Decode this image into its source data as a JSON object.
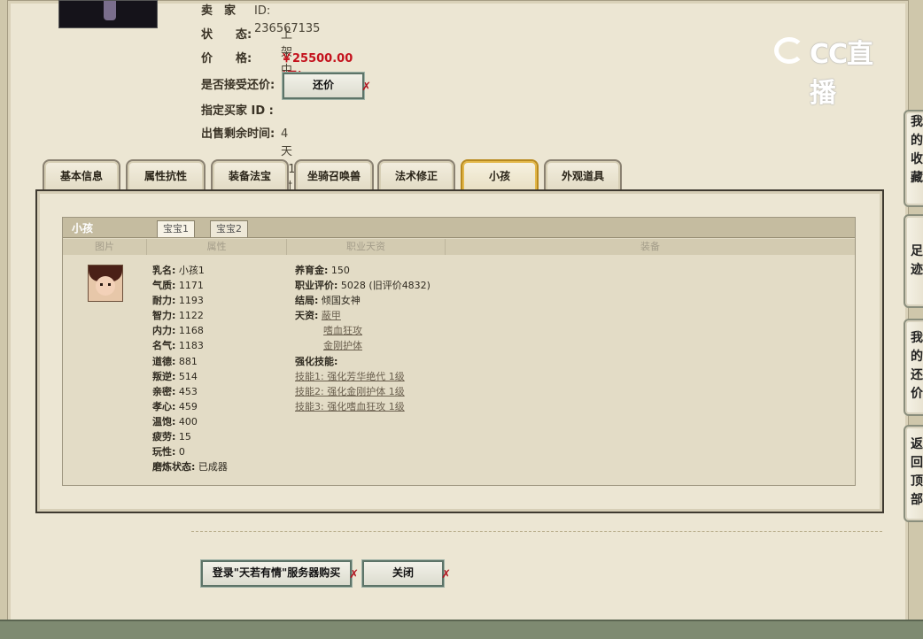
{
  "seller": {
    "seller_label": "卖　家",
    "seller_id": "ID:  236567135",
    "status_label": "状　　态:",
    "status_value": "上架中",
    "price_label": "价　　格:",
    "price_value": "￥25500.00 (元)",
    "counter_label": "是否接受还价:",
    "counter_button": "还价",
    "buyer_label": "指定买家 ID :",
    "time_label": "出售剩余时间:",
    "time_value": "4天21时"
  },
  "watermark": {
    "text": "CC直播"
  },
  "tabs": [
    {
      "label": "基本信息"
    },
    {
      "label": "属性抗性"
    },
    {
      "label": "装备法宝"
    },
    {
      "label": "坐骑召唤兽"
    },
    {
      "label": "法术修正"
    },
    {
      "label": "小孩"
    },
    {
      "label": "外观道具"
    }
  ],
  "child_panel": {
    "title": "小孩",
    "subtabs": [
      "宝宝1",
      "宝宝2"
    ],
    "columns": [
      "图片",
      "属性",
      "职业天资",
      "装备"
    ],
    "stats": [
      {
        "k": "乳名:",
        "v": "小孩1"
      },
      {
        "k": "气质:",
        "v": "1171"
      },
      {
        "k": "耐力:",
        "v": "1193"
      },
      {
        "k": "智力:",
        "v": "1122"
      },
      {
        "k": "内力:",
        "v": "1168"
      },
      {
        "k": "名气:",
        "v": "1183"
      },
      {
        "k": "道德:",
        "v": "881"
      },
      {
        "k": "叛逆:",
        "v": "514"
      },
      {
        "k": "亲密:",
        "v": "453"
      },
      {
        "k": "孝心:",
        "v": "459"
      },
      {
        "k": "温饱:",
        "v": "400"
      },
      {
        "k": "疲劳:",
        "v": "15"
      },
      {
        "k": "玩性:",
        "v": "0"
      },
      {
        "k": "磨炼状态:",
        "v": "已成器"
      }
    ],
    "career": {
      "support_label": "养育金:",
      "support_value": "150",
      "eval_label": "职业评价:",
      "eval_value": "5028 (旧评价4832)",
      "ending_label": "结局:",
      "ending_value": "倾国女神",
      "talent_label": "天资:",
      "talents": [
        "蔽甲",
        "嗜血狂攻",
        "金刚护体"
      ],
      "skill_label": "强化技能:",
      "skills": [
        "技能1: 强化芳华绝代 1级",
        "技能2: 强化金刚护体 1级",
        "技能3: 强化嗜血狂攻 1级"
      ]
    }
  },
  "footer": {
    "buy_button": "登录\"天若有情\"服务器购买",
    "close_button": "关闭"
  },
  "side_buttons": [
    {
      "text": "我的收藏"
    },
    {
      "text": "足迹"
    },
    {
      "text": "我的还价"
    },
    {
      "text": "返回顶部"
    }
  ]
}
